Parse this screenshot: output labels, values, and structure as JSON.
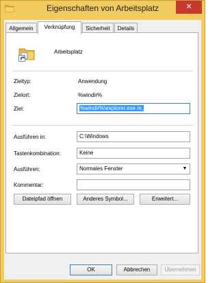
{
  "window": {
    "title": "Eigenschaften von Arbeitsplatz",
    "close_symbol": "✕",
    "frame_color": "#f1cb5f"
  },
  "tabs": [
    {
      "label": "Allgemein",
      "active": false
    },
    {
      "label": "Verknüpfung",
      "active": true
    },
    {
      "label": "Sicherheit",
      "active": false
    },
    {
      "label": "Details",
      "active": false
    }
  ],
  "shortcut": {
    "name": "Arbeitsplatz",
    "icon": "folder-shortcut-icon"
  },
  "properties": {
    "target_type_label": "Zieltyp:",
    "target_type_value": "Anwendung",
    "target_location_label": "Zielort:",
    "target_location_value": "%windir%",
    "target_label": "Ziel:",
    "target_value": "%windir%\\explorer.exe /e,",
    "start_in_label": "Ausführen in:",
    "start_in_value": "C:\\Windows",
    "shortcut_key_label": "Tastenkombination:",
    "shortcut_key_value": "Keine",
    "run_label": "Ausführen:",
    "run_value": "Normales Fenster",
    "comment_label": "Kommentar:",
    "comment_value": ""
  },
  "panel_buttons": {
    "open_location": "Dateipfad öffnen",
    "change_icon": "Anderes Symbol...",
    "advanced": "Erweitert..."
  },
  "dialog_buttons": {
    "ok": "OK",
    "cancel": "Abbrechen",
    "apply": "Übernehmen"
  }
}
